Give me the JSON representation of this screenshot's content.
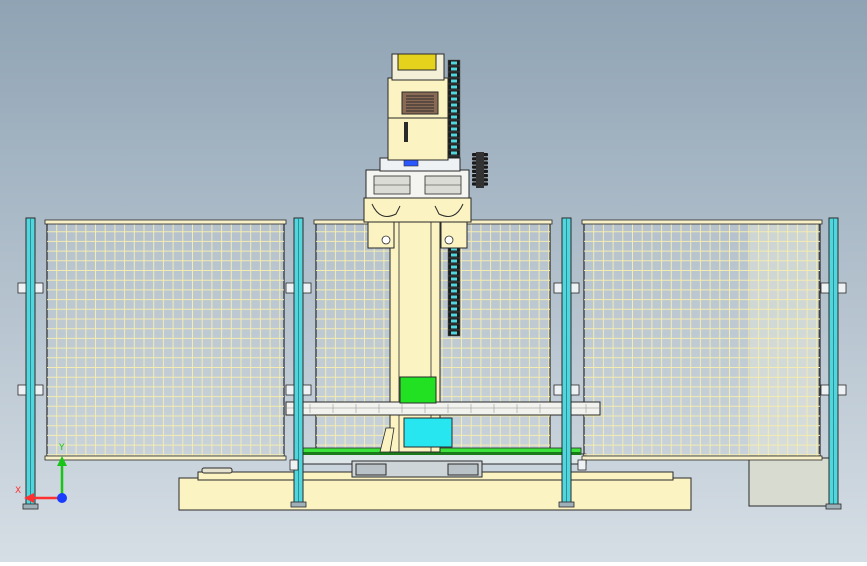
{
  "view": {
    "background_top": "#8fa3b4",
    "background_bottom": "#d6dee5"
  },
  "axis_triad": {
    "x_label": "X",
    "y_label": "Y",
    "x_color": "#ff3030",
    "y_color": "#17c417",
    "z_color": "#1a3cff"
  },
  "palette": {
    "fence_post": "#52d6de",
    "fence_mesh": "#f4ecb0",
    "mesh_bg": "#c8d0d6",
    "machine_body": "#fbf3c2",
    "outline": "#2a2a2a",
    "motor_cap": "#e5d21c",
    "vent": "#8a6a55",
    "green_block": "#22e022",
    "cyan_box": "#28e6f0",
    "green_rail": "#3ce23c",
    "base": "#fbf3c2",
    "cabinet": "#d7dbd0"
  }
}
